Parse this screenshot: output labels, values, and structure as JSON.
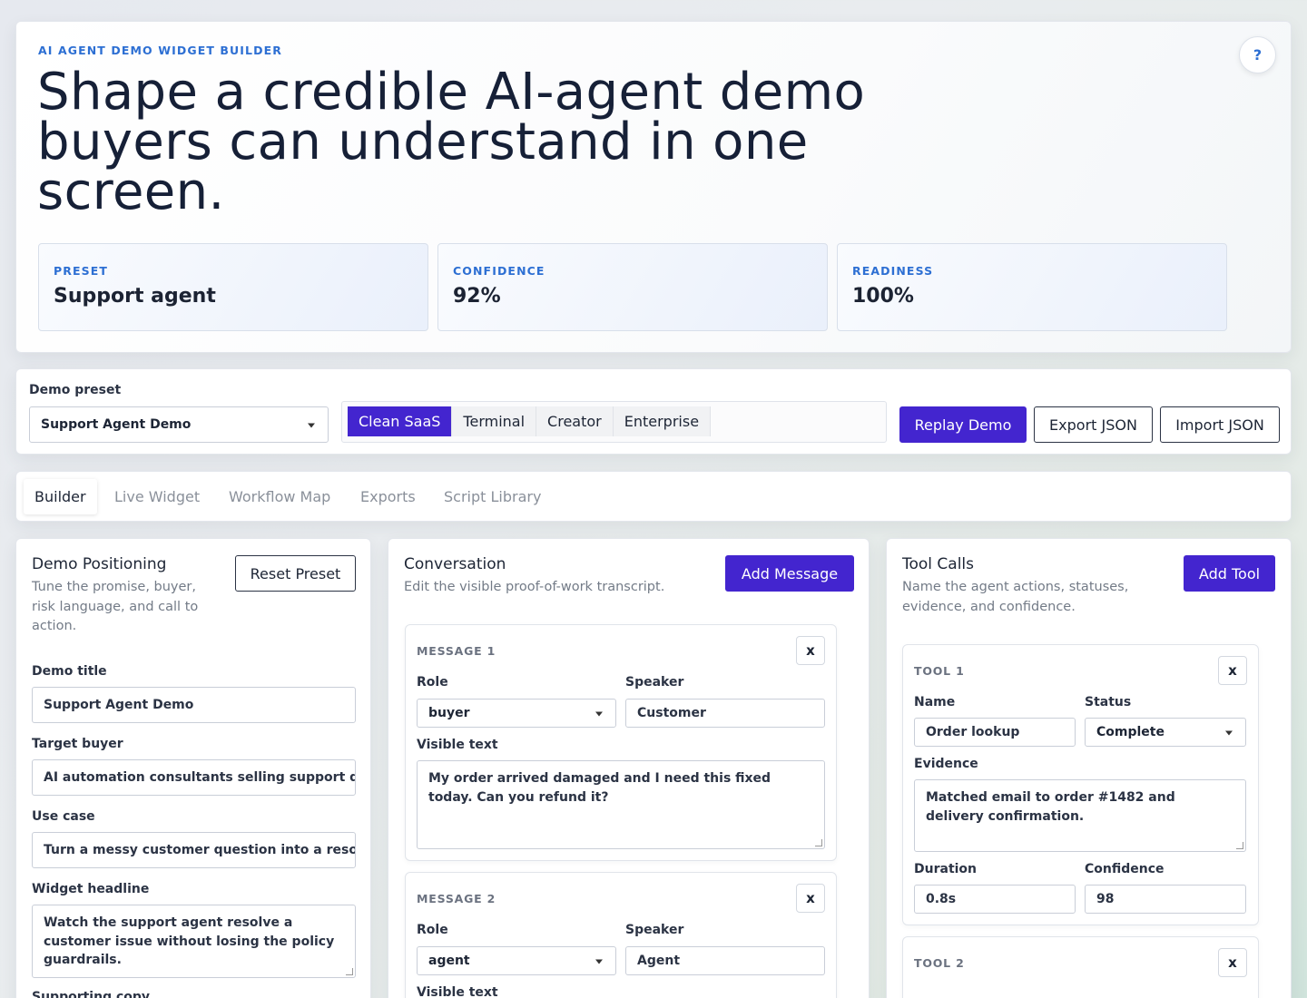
{
  "hero": {
    "eyebrow": "AI AGENT DEMO WIDGET BUILDER",
    "title": "Shape a credible AI-agent demo buyers can understand in one screen.",
    "help": "?",
    "stats": [
      {
        "label": "PRESET",
        "value": "Support agent"
      },
      {
        "label": "CONFIDENCE",
        "value": "92%"
      },
      {
        "label": "READINESS",
        "value": "100%"
      }
    ]
  },
  "toolbar": {
    "preset_label": "Demo preset",
    "preset_value": "Support Agent Demo",
    "themes": [
      "Clean SaaS",
      "Terminal",
      "Creator",
      "Enterprise"
    ],
    "active_theme": "Clean SaaS",
    "replay": "Replay Demo",
    "export": "Export JSON",
    "import": "Import JSON"
  },
  "tabs": [
    "Builder",
    "Live Widget",
    "Workflow Map",
    "Exports",
    "Script Library"
  ],
  "positioning": {
    "title": "Demo Positioning",
    "subtitle": "Tune the promise, buyer, risk language, and call to action.",
    "reset": "Reset Preset",
    "fields": {
      "demo_title_label": "Demo title",
      "demo_title": "Support Agent Demo",
      "target_buyer_label": "Target buyer",
      "target_buyer": "AI automation consultants selling support d",
      "use_case_label": "Use case",
      "use_case": "Turn a messy customer question into a reso",
      "headline_label": "Widget headline",
      "headline": "Watch the support agent resolve a customer issue without losing the policy guardrails.",
      "supporting_label": "Supporting copy"
    }
  },
  "conversation": {
    "title": "Conversation",
    "subtitle": "Edit the visible proof-of-work transcript.",
    "add": "Add Message",
    "role_label": "Role",
    "speaker_label": "Speaker",
    "text_label": "Visible text",
    "messages": [
      {
        "head": "MESSAGE 1",
        "role": "buyer",
        "speaker": "Customer",
        "text": "My order arrived damaged and I need this fixed today. Can you refund it?"
      },
      {
        "head": "MESSAGE 2",
        "role": "agent",
        "speaker": "Agent",
        "text": ""
      }
    ]
  },
  "tools": {
    "title": "Tool Calls",
    "subtitle": "Name the agent actions, statuses, evidence, and confidence.",
    "add": "Add Tool",
    "name_label": "Name",
    "status_label": "Status",
    "evidence_label": "Evidence",
    "duration_label": "Duration",
    "confidence_label": "Confidence",
    "items": [
      {
        "head": "TOOL 1",
        "name": "Order lookup",
        "status": "Complete",
        "evidence": "Matched email to order #1482 and delivery confirmation.",
        "duration": "0.8s",
        "confidence": "98"
      },
      {
        "head": "TOOL 2"
      }
    ]
  },
  "close_glyph": "x",
  "colors": {
    "accent": "#4325cf",
    "eyebrow": "#2d6fd3",
    "text": "#16213a"
  }
}
